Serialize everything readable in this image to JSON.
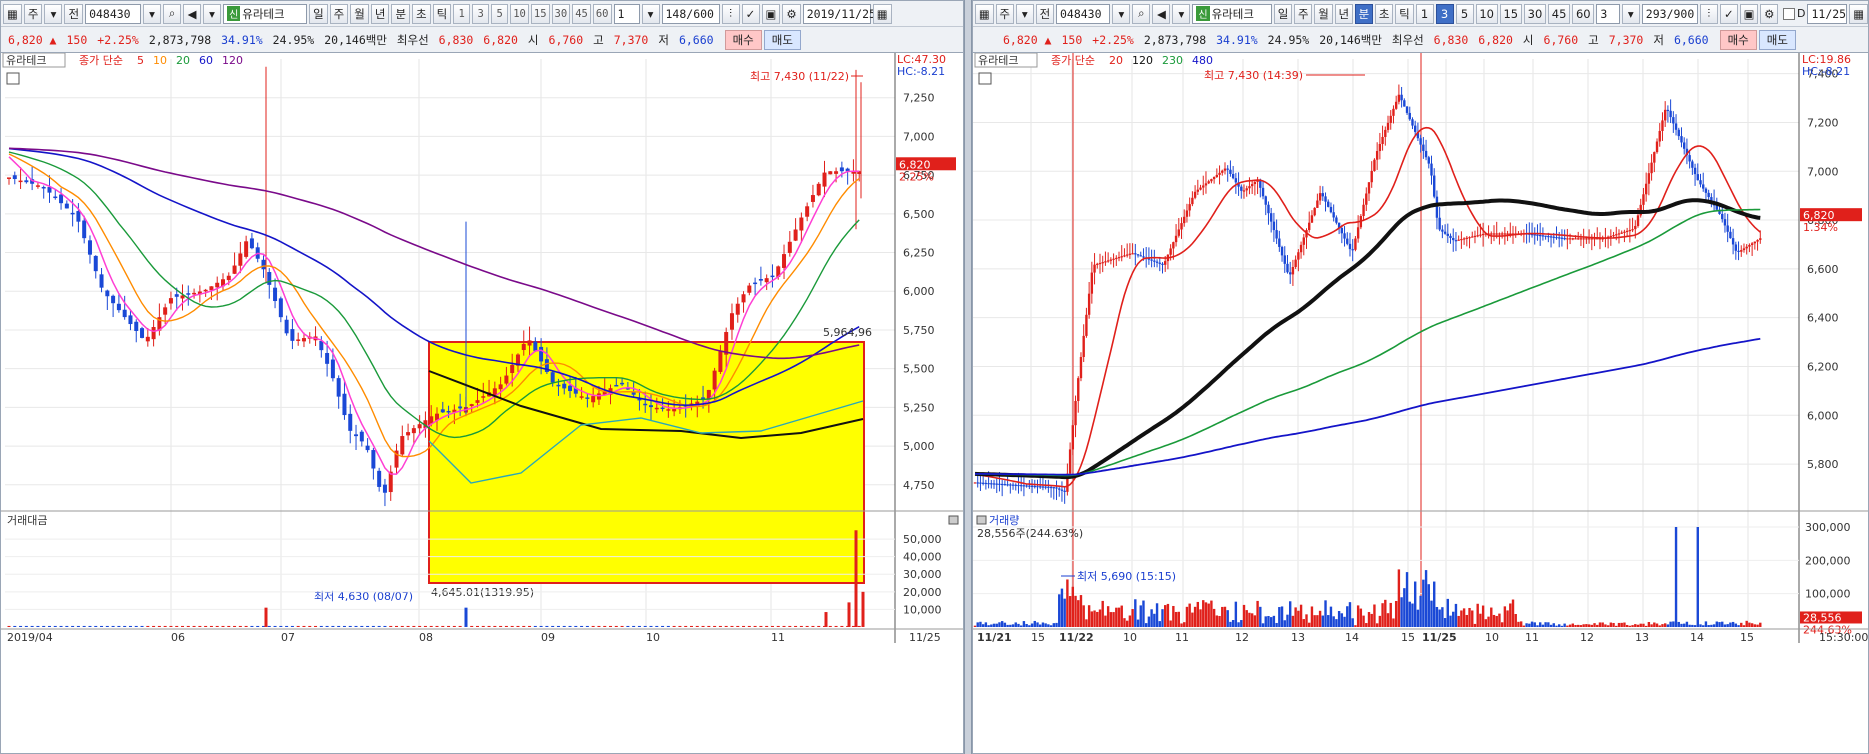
{
  "left": {
    "toolbar": {
      "menu_label": "주",
      "type_label": "전",
      "code": "048430",
      "name": "유라테크",
      "periods": [
        "일",
        "주",
        "월",
        "년",
        "분",
        "초",
        "틱"
      ],
      "active_period": "일",
      "nums": [
        "1",
        "3",
        "5",
        "10",
        "15",
        "30",
        "45",
        "60"
      ],
      "count_value": "1",
      "page_label": "148/600",
      "date": "2019/11/25"
    },
    "info": {
      "price": "6,820",
      "change": "150",
      "pct": "+2.25%",
      "volume": "2,873,798",
      "ratio1": "34.91%",
      "ratio2": "24.95%",
      "amount": "20,146백만",
      "best_label": "최우선",
      "ask": "6,830",
      "bid": "6,820",
      "open_label": "시",
      "open": "6,760",
      "high_label": "고",
      "high": "7,370",
      "low_label": "저",
      "low": "6,660",
      "buy_label": "매수",
      "sell_label": "매도"
    },
    "legend": {
      "name": "유라테크",
      "ma_label": "종가 단순",
      "periods": [
        "5",
        "10",
        "20",
        "60",
        "120"
      ]
    },
    "lc": "LC:47.30",
    "hc": "HC:-8.21",
    "price_ticks": [
      "7,250",
      "7,000",
      "6,750",
      "6,500",
      "6,250",
      "6,000",
      "5,750",
      "5,500",
      "5,250",
      "5,000",
      "4,750"
    ],
    "cur_price": "6,820",
    "cur_pct": "2.25%",
    "max_label": "최고 7,430 (11/22)",
    "min_label": "최저 4,630 (08/07)",
    "box_top_label": "5,964,96",
    "box_bot_label": "4,645.01(1319.95)",
    "vol_title": "거래대금",
    "vol_ticks": [
      "50,000",
      "40,000",
      "30,000",
      "20,000",
      "10,000"
    ],
    "date_labels": [
      "2019/04",
      "06",
      "07",
      "08",
      "09",
      "10",
      "11",
      "11/25"
    ]
  },
  "right": {
    "toolbar": {
      "menu_label": "주",
      "type_label": "전",
      "code": "048430",
      "name": "유라테크",
      "periods": [
        "일",
        "주",
        "월",
        "년",
        "분",
        "초",
        "틱"
      ],
      "active_period": "분",
      "nums": [
        "1",
        "3",
        "5",
        "10",
        "15",
        "30",
        "45",
        "60"
      ],
      "active_num": "3",
      "count_value": "3",
      "page_label": "293/900",
      "date": "11/25",
      "d_label": "D"
    },
    "info": {
      "price": "6,820",
      "change": "150",
      "pct": "+2.25%",
      "volume": "2,873,798",
      "ratio1": "34.91%",
      "ratio2": "24.95%",
      "amount": "20,146백만",
      "best_label": "최우선",
      "ask": "6,830",
      "bid": "6,820",
      "open_label": "시",
      "open": "6,760",
      "high_label": "고",
      "high": "7,370",
      "low_label": "저",
      "low": "6,660",
      "buy_label": "매수",
      "sell_label": "매도"
    },
    "legend": {
      "name": "유라테크",
      "ma_label": "종가 단순",
      "periods": [
        "20",
        "120",
        "230",
        "480"
      ]
    },
    "lc": "LC:19.86",
    "hc": "HC:-8.21",
    "price_ticks": [
      "7,400",
      "7,200",
      "7,000",
      "6,800",
      "6,600",
      "6,400",
      "6,200",
      "6,000",
      "5,800"
    ],
    "cur_price": "6,820",
    "cur_pct": "1.34%",
    "max_label": "최고 7,430 (14:39)",
    "min_label": "최저 5,690 (15:15)",
    "vol_title": "거래량",
    "vol_sub": "28,556주(244.63%)",
    "vol_ticks": [
      "300,000",
      "200,000",
      "100,000"
    ],
    "vol_cur": "28,556",
    "vol_cur_pct": "244.63%",
    "date_labels": [
      "11/21",
      "15",
      "11/22",
      "10",
      "11",
      "12",
      "13",
      "14",
      "15",
      "11/25",
      "10",
      "11",
      "12",
      "13",
      "14",
      "15"
    ],
    "time_label": "15:30:00"
  },
  "colors": {
    "up": "#e0201b",
    "down": "#1a48d6",
    "box": "#ffff00",
    "ma5": "#ff3fd4",
    "ma20": "#1a9a3a",
    "ma60": "#1414c8",
    "ma120": "#7a0a8a"
  }
}
